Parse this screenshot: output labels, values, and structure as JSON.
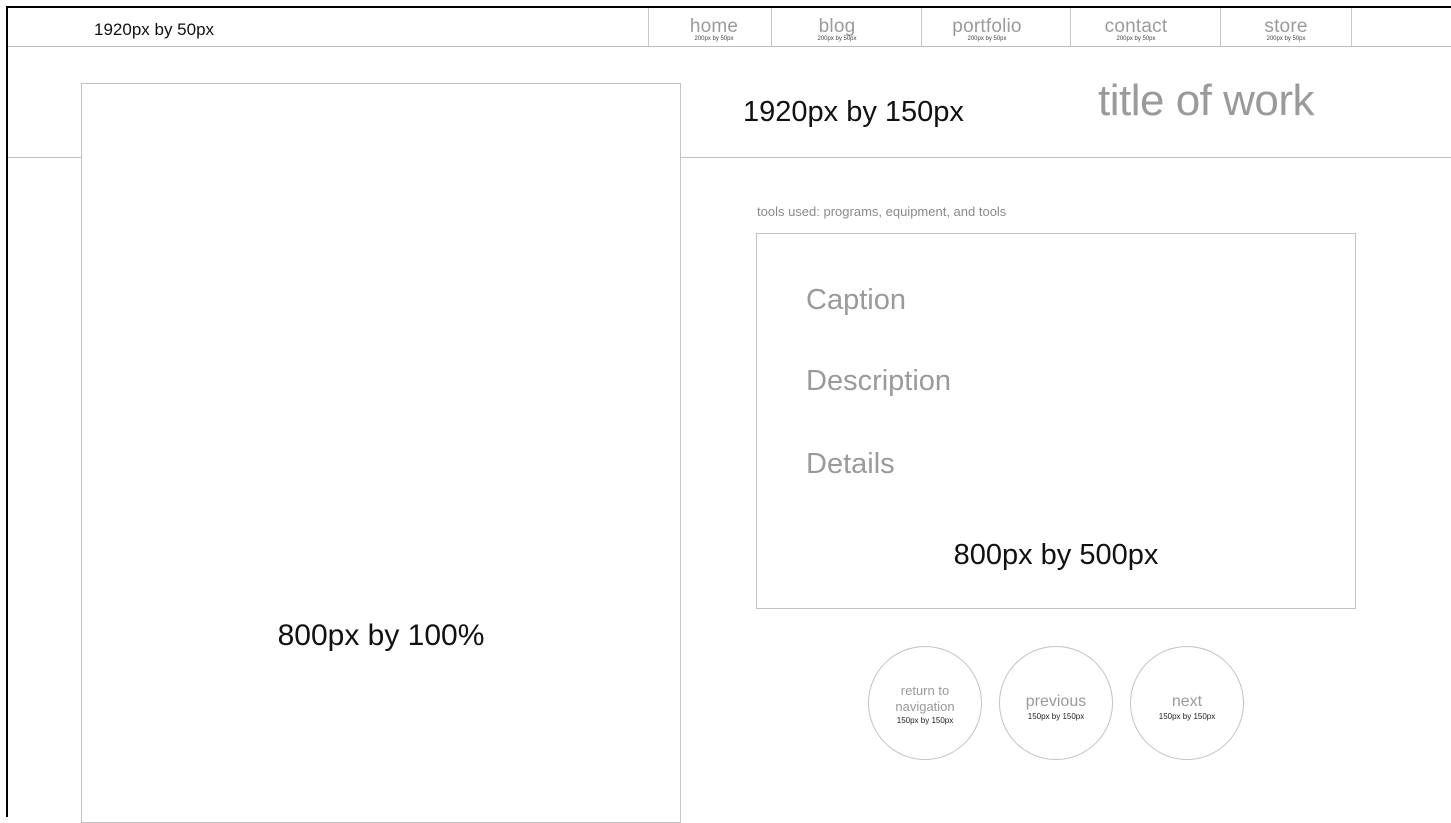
{
  "topbar": {
    "label": "1920px by 50px",
    "nav": [
      {
        "label": "home",
        "size": "200px by 50px"
      },
      {
        "label": "blog",
        "size": "200px by 50px"
      },
      {
        "label": "portfolio",
        "size": "200px by 50px"
      },
      {
        "label": "contact",
        "size": "200px by 50px"
      },
      {
        "label": "store",
        "size": "200px by 50px"
      }
    ]
  },
  "header": {
    "size_label": "1920px by 150px",
    "title": "title of work"
  },
  "image_panel": {
    "size_label": "800px by 100%"
  },
  "details": {
    "tools_used": "tools used: programs, equipment, and tools",
    "caption": "Caption",
    "description": "Description",
    "details": "Details",
    "size_label": "800px by 500px"
  },
  "buttons": {
    "return": {
      "label_line1": "return to",
      "label_line2": "navigation",
      "size": "150px by 150px"
    },
    "previous": {
      "label": "previous",
      "size": "150px by 150px"
    },
    "next": {
      "label": "next",
      "size": "150px by 150px"
    }
  },
  "colors": {
    "muted_text": "#9a9a9a",
    "border": "#c2c2c2",
    "frame": "#000000"
  }
}
